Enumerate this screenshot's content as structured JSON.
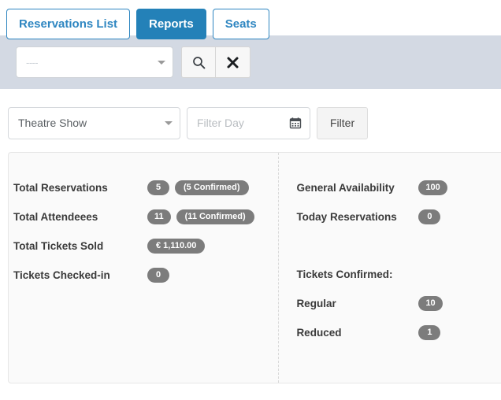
{
  "tabs": [
    {
      "label": "Reservations List",
      "active": false
    },
    {
      "label": "Reports",
      "active": true
    },
    {
      "label": "Seats",
      "active": false
    }
  ],
  "search_band": {
    "select_value": "----",
    "search_icon": "search-icon",
    "clear_icon": "close-icon"
  },
  "filter_row": {
    "event_select_value": "Theatre Show",
    "day_placeholder": "Filter Day",
    "day_value": "",
    "calendar_icon": "calendar-icon",
    "filter_button_label": "Filter"
  },
  "stats": {
    "left": [
      {
        "label": "Total Reservations",
        "value": "5",
        "note": "(5 Confirmed)"
      },
      {
        "label": "Total Attendeees",
        "value": "11",
        "note": "(11 Confirmed)"
      },
      {
        "label": "Total Tickets Sold",
        "value": "€ 1,110.00",
        "note": ""
      },
      {
        "label": "Tickets Checked-in",
        "value": "0",
        "note": ""
      }
    ],
    "right": [
      {
        "label": "General Availability",
        "value": "100",
        "note": ""
      },
      {
        "label": "Today Reservations",
        "value": "0",
        "note": ""
      }
    ],
    "tickets_confirmed_title": "Tickets Confirmed:",
    "tickets_confirmed": [
      {
        "label": "Regular",
        "value": "10",
        "note": ""
      },
      {
        "label": "Reduced",
        "value": "1",
        "note": ""
      }
    ]
  },
  "colors": {
    "accent_blue": "#2481b8",
    "tab_border_blue": "#2e86c1",
    "band_background": "#d3d9e3",
    "badge_grey": "#7c7c7c",
    "panel_background": "#fafafa"
  }
}
